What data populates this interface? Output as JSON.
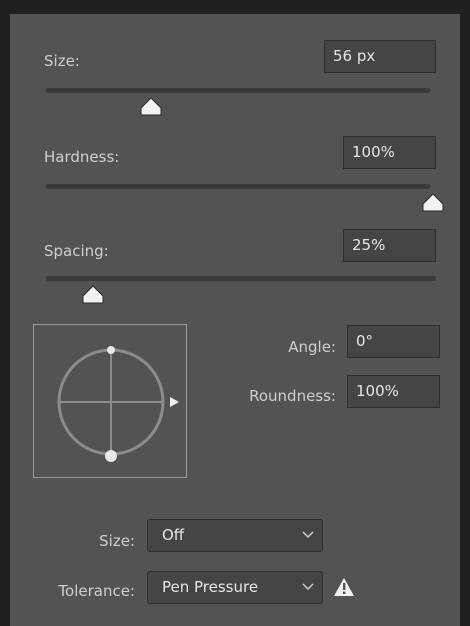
{
  "brush": {
    "size": {
      "label": "Size:",
      "value": "56 px",
      "slider_fraction": 0.27
    },
    "hardness": {
      "label": "Hardness:",
      "value": "100%",
      "slider_fraction": 1.0
    },
    "spacing": {
      "label": "Spacing:",
      "value": "25%",
      "slider_fraction": 0.11
    },
    "angle": {
      "label": "Angle:",
      "value": "0°"
    },
    "roundness": {
      "label": "Roundness:",
      "value": "100%"
    }
  },
  "controls": {
    "size_control": {
      "label": "Size:",
      "value": "Off"
    },
    "tolerance_control": {
      "label": "Tolerance:",
      "value": "Pen Pressure"
    }
  },
  "icons": {
    "dropdown": "chevron-down-icon",
    "warning": "warning-icon",
    "brush_preview": "brush-tip-preview-icon"
  }
}
